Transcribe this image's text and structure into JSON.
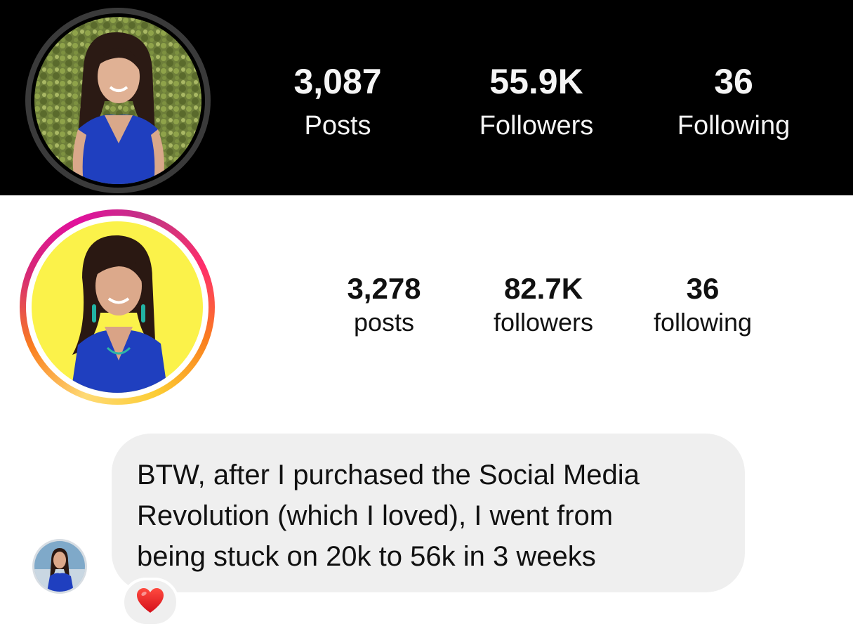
{
  "profile_dark": {
    "stats": [
      {
        "value": "3,087",
        "label": "Posts"
      },
      {
        "value": "55.9K",
        "label": "Followers"
      },
      {
        "value": "36",
        "label": "Following"
      }
    ]
  },
  "profile_light": {
    "stats": [
      {
        "value": "3,278",
        "label": "posts"
      },
      {
        "value": "82.7K",
        "label": "followers"
      },
      {
        "value": "36",
        "label": "following"
      }
    ]
  },
  "message": {
    "lines": [
      "BTW, after I purchased the Social Media",
      "Revolution (which I loved), I went from",
      "being stuck on 20k to 56k in 3 weeks"
    ],
    "reaction_icon": "red-heart-icon"
  },
  "colors": {
    "dark_bg": "#000000",
    "bubble_bg": "#efefef",
    "story_ring": [
      "#feda75",
      "#fa7e1e",
      "#d62976",
      "#e1109d"
    ],
    "avatar_bg_light": "#fbf24a",
    "dress_blue": "#1f3fbf"
  }
}
